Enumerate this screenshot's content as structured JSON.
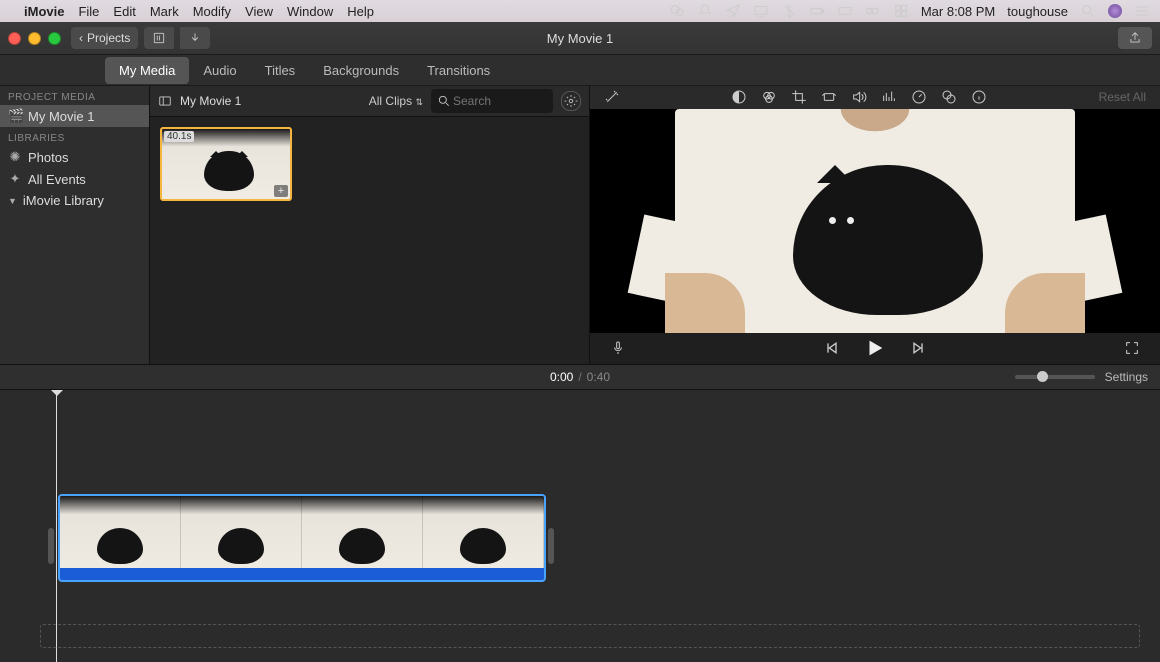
{
  "menubar": {
    "app": "iMovie",
    "items": [
      "File",
      "Edit",
      "Mark",
      "Modify",
      "View",
      "Window",
      "Help"
    ],
    "status": {
      "date": "Mar 8:08 PM",
      "user": "toughouse"
    }
  },
  "toolbar": {
    "projects_label": "Projects",
    "title": "My Movie 1"
  },
  "tabs": {
    "items": [
      "My Media",
      "Audio",
      "Titles",
      "Backgrounds",
      "Transitions"
    ],
    "active_index": 0
  },
  "sidebar": {
    "project_head": "PROJECT MEDIA",
    "project": "My Movie 1",
    "libraries_head": "LIBRARIES",
    "photos": "Photos",
    "all_events": "All Events",
    "imovie_library": "iMovie Library"
  },
  "browser": {
    "title": "My Movie 1",
    "filter": "All Clips",
    "search_placeholder": "Search",
    "clip_duration": "40.1s"
  },
  "preview": {
    "reset": "Reset All"
  },
  "time": {
    "current": "0:00",
    "total": "0:40",
    "separator": "/",
    "settings": "Settings"
  }
}
